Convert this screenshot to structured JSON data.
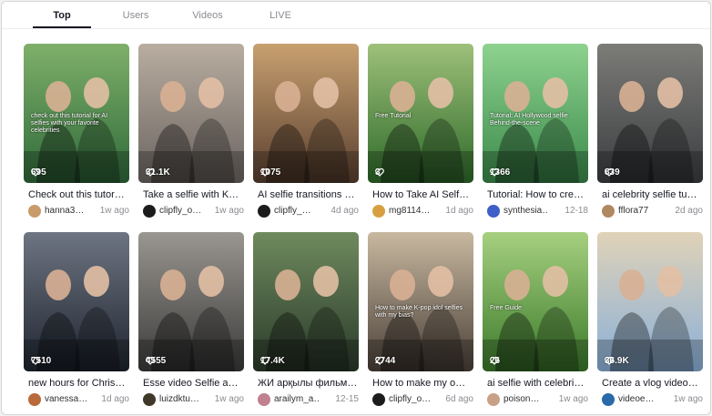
{
  "tabs": [
    {
      "label": "Top",
      "active": true
    },
    {
      "label": "Users",
      "active": false
    },
    {
      "label": "Videos",
      "active": false
    },
    {
      "label": "LIVE",
      "active": false
    }
  ],
  "videos": [
    {
      "views": "695",
      "title": "Check out this tutor…",
      "user": "hanna3…",
      "date": "1w ago",
      "overlay": "check out this tutorial for AI selfies with your favorite celebrities",
      "bg": [
        "#2f6a3a",
        "#7fb06a"
      ],
      "avatar": "#c99a6a"
    },
    {
      "views": "31.1K",
      "title": "Take a selfie with K…",
      "user": "clipfly_o…",
      "date": "1w ago",
      "overlay": "",
      "bg": [
        "#6a6460",
        "#b9ada0"
      ],
      "avatar": "#1c1c1c"
    },
    {
      "views": "1075",
      "title": "AI selfie transitions …",
      "user": "clipfly_…",
      "date": "4d ago",
      "overlay": "",
      "bg": [
        "#5a4030",
        "#c8a070"
      ],
      "avatar": "#1c1c1c"
    },
    {
      "views": "3",
      "title": "How to Take AI Self…",
      "user": "mg8114…",
      "date": "1d ago",
      "overlay": "Free Tutorial",
      "bg": [
        "#2e6a2a",
        "#9ec07a"
      ],
      "avatar": "#d6a040"
    },
    {
      "views": "1366",
      "title": "Tutorial: How to cre…",
      "user": "synthesia…",
      "date": "12-18",
      "overlay": "Tutorial: AI Hollywood selfie Behind-the-scene",
      "bg": [
        "#3a8a4a",
        "#8fd28f"
      ],
      "avatar": "#3e5ec8"
    },
    {
      "views": "839",
      "title": "ai celebrity selfie tu…",
      "user": "fflora77",
      "date": "2d ago",
      "overlay": "",
      "bg": [
        "#3a3d40",
        "#7c7c78"
      ],
      "avatar": "#b08860"
    },
    {
      "views": "7510",
      "title": "new hours for Chris…",
      "user": "vanessa…",
      "date": "1d ago",
      "overlay": "",
      "bg": [
        "#1e2530",
        "#6e7582"
      ],
      "avatar": "#b86a3a"
    },
    {
      "views": "4555",
      "title": "Esse video Selfie a…",
      "user": "luizdktu…",
      "date": "1w ago",
      "overlay": "",
      "bg": [
        "#3a3a3a",
        "#9a9690"
      ],
      "avatar": "#403828"
    },
    {
      "views": "17.4K",
      "title": "ЖИ арқылы фильм…",
      "user": "arailym_a…",
      "date": "12-15",
      "overlay": "",
      "bg": [
        "#2a3a2a",
        "#6f8a5e"
      ],
      "avatar": "#c08090"
    },
    {
      "views": "2744",
      "title": "How to make my o…",
      "user": "clipfly_o…",
      "date": "6d ago",
      "overlay": "How to make K-pop idol selfies with my bias?",
      "bg": [
        "#4a4038",
        "#c8b8a0"
      ],
      "avatar": "#1c1c1c"
    },
    {
      "views": "26",
      "title": "ai selfie with celebri…",
      "user": "poison…",
      "date": "1w ago",
      "overlay": "Free Guide",
      "bg": [
        "#3a7a2a",
        "#a6d080"
      ],
      "avatar": "#c8a088"
    },
    {
      "views": "36.9K",
      "title": "Create a vlog video…",
      "user": "videoe…",
      "date": "1w ago",
      "overlay": "",
      "bg": [
        "#8ab0d8",
        "#e0d2b8"
      ],
      "avatar": "#2a6aa8"
    }
  ],
  "accent_color": "#161823"
}
